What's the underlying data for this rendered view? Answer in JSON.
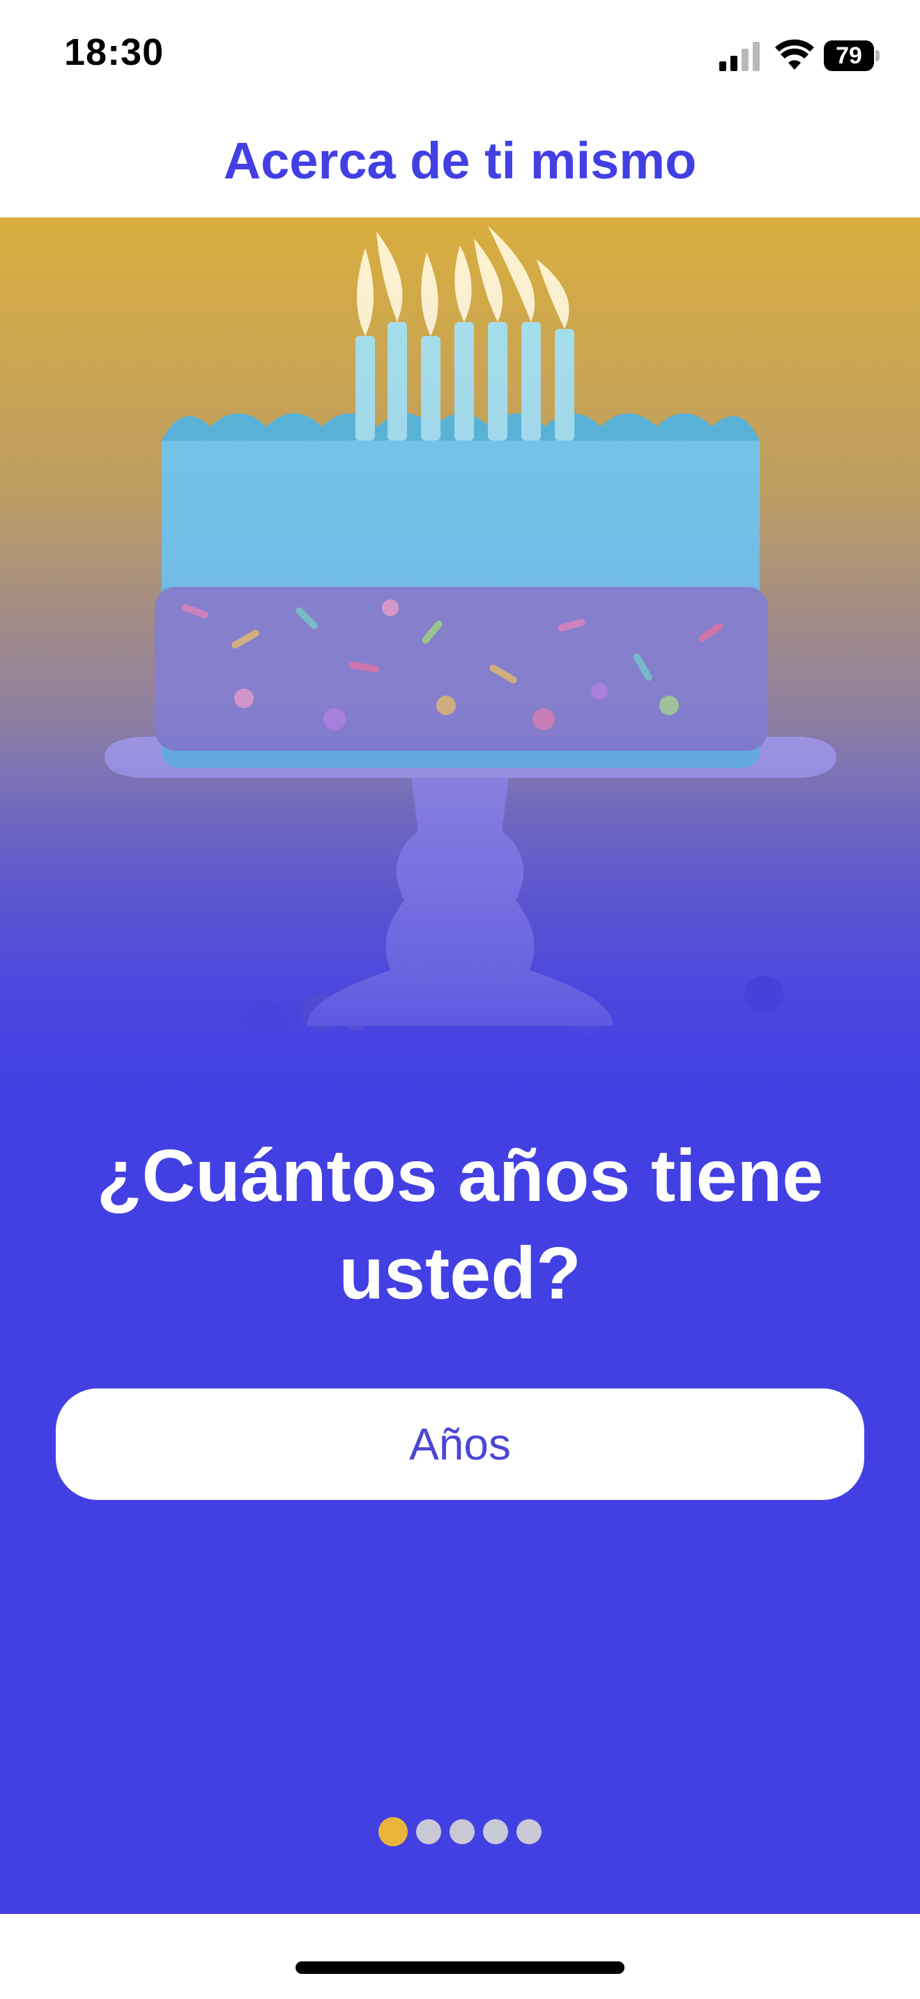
{
  "status_bar": {
    "time": "18:30",
    "battery_level": "79",
    "icons": [
      "signal-icon",
      "wifi-icon",
      "battery-icon"
    ]
  },
  "nav": {
    "title": "Acerca de ti mismo"
  },
  "hero": {
    "image": "birthday-cake-illustration"
  },
  "question": {
    "line1": "¿Cuántos años tiene",
    "line2": "usted?"
  },
  "age_field": {
    "placeholder": "Años",
    "value": ""
  },
  "pagination": {
    "total": 5,
    "current": 1
  },
  "colors": {
    "accent": "#4240e3",
    "dot_active": "#e8b53a",
    "dot_inactive": "#c9c9d6"
  }
}
